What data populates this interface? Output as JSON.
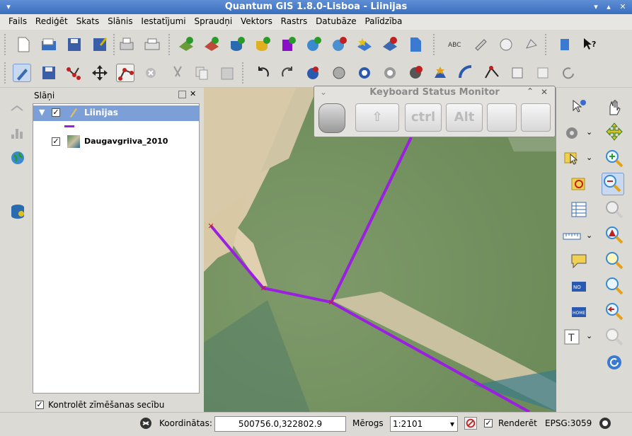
{
  "window": {
    "title": "Quantum GIS 1.8.0-Lisboa - Liinijas"
  },
  "menu": [
    "Fails",
    "Rediģēt",
    "Skats",
    "Slānis",
    "Iestatījumi",
    "Spraudņi",
    "Vektors",
    "Rastrs",
    "Datubāze",
    "Palīdzība"
  ],
  "layers_panel": {
    "title": "Slāņi",
    "layers": [
      {
        "name": "Liinijas",
        "checked": true,
        "selected": true
      },
      {
        "name": "Daugavgriiva_2010",
        "checked": true,
        "selected": false
      }
    ],
    "render_order_label": "Kontrolēt zīmēšanas secību"
  },
  "keyboard_monitor": {
    "title": "Keyboard Status Monitor",
    "keys": [
      "ctrl",
      "Alt"
    ]
  },
  "statusbar": {
    "coordinates_label": "Koordinātas:",
    "coordinates_value": "500756.0,322802.9",
    "scale_label": "Mērogs",
    "scale_value": "1:2101",
    "render_label": "Renderēt",
    "render_checked": true,
    "crs": "EPSG:3059"
  },
  "colors": {
    "line": "#9b1fe0",
    "titlebar": "#4a7ccc",
    "selection": "#7b9fd6"
  }
}
